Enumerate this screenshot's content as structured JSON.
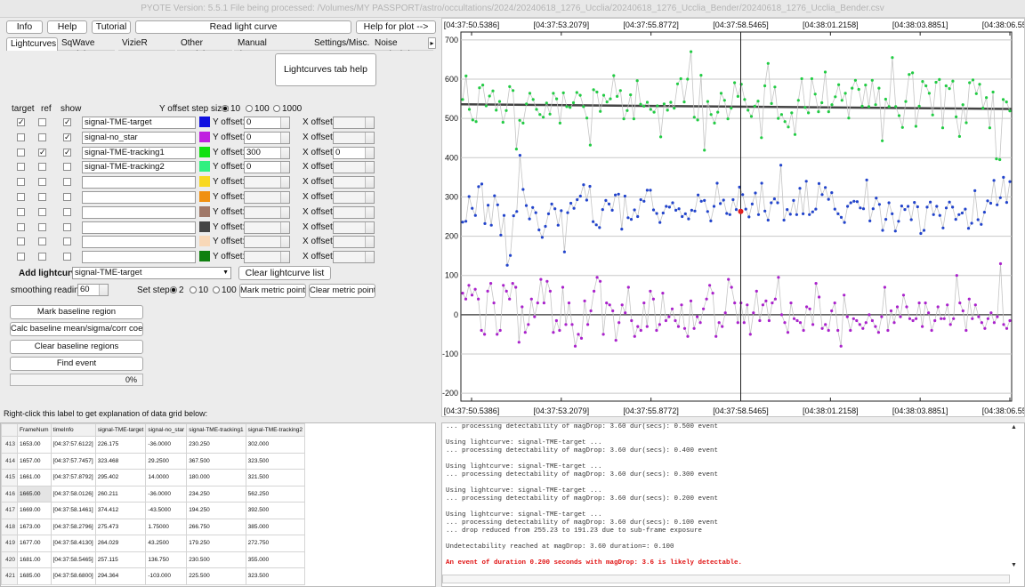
{
  "window": {
    "title": "PYOTE Version: 5.5.1  File being processed: /Volumes/MY PASSPORT/astro/occultations/2024/20240618_1276_Ucclia/20240618_1276_Ucclia_Bender/20240618_1276_Ucclia_Bender.csv"
  },
  "toolbar": {
    "info": "Info",
    "help": "Help",
    "tutorial": "Tutorial",
    "read": "Read light curve",
    "help_plot": "Help for plot -->"
  },
  "tabs": [
    "Lightcurves",
    "SqWave model",
    "VizieR export",
    "Other models",
    "Manual timestamps",
    "Settings/Misc.",
    "Noise analysis/"
  ],
  "lc": {
    "help_btn": "Lightcurves tab help",
    "hdr_target": "target",
    "hdr_ref": "ref",
    "hdr_show": "show",
    "yoffset_step": "Y offset step size:",
    "steps": [
      "10",
      "100",
      "1000"
    ],
    "y_label": "Y offset:",
    "x_label": "X offset:",
    "rows": [
      {
        "name": "signal-TME-target",
        "color": "#1010e0",
        "target": "✓",
        "ref": "",
        "show": "✓",
        "y": "0",
        "x": ""
      },
      {
        "name": "signal-no_star",
        "color": "#c020e0",
        "target": "",
        "ref": "",
        "show": "✓",
        "y": "0",
        "x": ""
      },
      {
        "name": "signal-TME-tracking1",
        "color": "#10e010",
        "target": "",
        "ref": "✓",
        "show": "✓",
        "y": "300",
        "x": "0"
      },
      {
        "name": "signal-TME-tracking2",
        "color": "#30f080",
        "target": "",
        "ref": "",
        "show": "",
        "y": "0",
        "x": ""
      },
      {
        "name": "",
        "color": "#f8d820",
        "target": "",
        "ref": "",
        "show": "",
        "y": "",
        "x": ""
      },
      {
        "name": "",
        "color": "#f09010",
        "target": "",
        "ref": "",
        "show": "",
        "y": "",
        "x": ""
      },
      {
        "name": "",
        "color": "#a07868",
        "target": "",
        "ref": "",
        "show": "",
        "y": "",
        "x": ""
      },
      {
        "name": "",
        "color": "#444444",
        "target": "",
        "ref": "",
        "show": "",
        "y": "",
        "x": ""
      },
      {
        "name": "",
        "color": "#f8d8b8",
        "target": "",
        "ref": "",
        "show": "",
        "y": "",
        "x": ""
      },
      {
        "name": "",
        "color": "#108010",
        "target": "",
        "ref": "",
        "show": "",
        "y": "",
        "x": ""
      }
    ],
    "add_label": "Add lightcurve",
    "add_value": "signal-TME-target",
    "clear_btn": "Clear lightcurve list",
    "smooth_label": "smoothing readings",
    "smooth_value": "60",
    "setstep_label": "Set step:",
    "setsteps": [
      "2",
      "10",
      "100"
    ],
    "mark_metric": "Mark metric points",
    "clear_metric": "Clear metric points",
    "mark_baseline": "Mark baseline region",
    "calc_baseline": "Calc baseline mean/sigma/corr coeffs",
    "clear_baseline": "Clear baseline regions",
    "find_event": "Find event",
    "progress": "0%"
  },
  "chart_data": {
    "type": "scatter",
    "x_ticks": [
      "[04:37:50.5386]",
      "[04:37:53.2079]",
      "[04:37:55.8772]",
      "[04:37:58.5465]",
      "[04:38:01.2158]",
      "[04:38:03.8851]",
      "[04:38:06.5544]"
    ],
    "y_ticks": [
      "700",
      "600",
      "500",
      "400",
      "300",
      "200",
      "100",
      "0",
      "-100",
      "-200"
    ],
    "ylim": [
      -220,
      720
    ],
    "baselines": [
      530,
      0
    ],
    "cursor_time": "[04:37:58.5465]",
    "highlight_value": 263,
    "series": [
      {
        "color": "#22cc44",
        "values": [
          548,
          608,
          523,
          496,
          492,
          578,
          585,
          532,
          557,
          570,
          521,
          543,
          490,
          520,
          581,
          571,
          422,
          495,
          488,
          537,
          564,
          548,
          523,
          510,
          503,
          539,
          511,
          564,
          550,
          488,
          565,
          530,
          528,
          540,
          566,
          559,
          530,
          501,
          432,
          573,
          567,
          518,
          559,
          542,
          550,
          609,
          556,
          571,
          499,
          520,
          560,
          499,
          596,
          536,
          531,
          541,
          523,
          516,
          532,
          453,
          537,
          521,
          541,
          526,
          588,
          601,
          542,
          600,
          670,
          503,
          496,
          610,
          419,
          543,
          510,
          488,
          516,
          564,
          546,
          499,
          526,
          591,
          556,
          587,
          548,
          521,
          505,
          531,
          544,
          451,
          583,
          640,
          538,
          580,
          500,
          510,
          492,
          478,
          514,
          459,
          546,
          601,
          528,
          514,
          601,
          562,
          517,
          540,
          618,
          517,
          535,
          555,
          586,
          546,
          564,
          501,
          577,
          597,
          574,
          531,
          585,
          530,
          597,
          535,
          577,
          443,
          549,
          530,
          655,
          530,
          507,
          477,
          543,
          612,
          616,
          480,
          531,
          594,
          583,
          564,
          509,
          592,
          599,
          476,
          583,
          576,
          595,
          504,
          454,
          535,
          489,
          591,
          598,
          563,
          587,
          526,
          553,
          476,
          567,
          397,
          395,
          548,
          542,
          519
        ]
      },
      {
        "color": "#2244cc",
        "values": [
          236,
          238,
          301,
          271,
          253,
          326,
          333,
          232,
          279,
          228,
          303,
          280,
          203,
          253,
          126,
          151,
          252,
          263,
          406,
          319,
          278,
          244,
          273,
          260,
          216,
          197,
          225,
          257,
          282,
          270,
          228,
          265,
          160,
          260,
          284,
          271,
          293,
          302,
          331,
          292,
          327,
          237,
          229,
          222,
          268,
          291,
          282,
          266,
          305,
          307,
          218,
          302,
          247,
          243,
          267,
          250,
          293,
          289,
          317,
          317,
          267,
          258,
          235,
          259,
          276,
          274,
          285,
          266,
          270,
          250,
          257,
          244,
          266,
          264,
          305,
          289,
          291,
          263,
          239,
          276,
          335,
          283,
          292,
          258,
          255,
          293,
          268,
          325,
          306,
          269,
          249,
          282,
          310,
          255,
          335,
          264,
          241,
          285,
          295,
          285,
          381,
          241,
          268,
          256,
          291,
          255,
          322,
          257,
          340,
          255,
          262,
          269,
          334,
          306,
          324,
          294,
          311,
          269,
          257,
          248,
          235,
          276,
          285,
          289,
          288,
          272,
          270,
          343,
          239,
          270,
          297,
          281,
          215,
          243,
          285,
          257,
          213,
          238,
          277,
          268,
          276,
          242,
          286,
          275,
          207,
          215,
          274,
          287,
          255,
          276,
          253,
          221,
          272,
          287,
          274,
          243,
          255,
          259,
          269,
          220,
          233,
          316,
          242,
          230,
          261,
          290,
          284,
          342,
          280,
          298,
          350,
          286,
          339
        ]
      },
      {
        "color": "#aa22cc",
        "values": [
          55,
          40,
          75,
          50,
          65,
          40,
          -40,
          -50,
          60,
          80,
          30,
          -50,
          -40,
          75,
          60,
          40,
          80,
          70,
          -70,
          20,
          -45,
          -25,
          40,
          -5,
          30,
          90,
          30,
          85,
          60,
          -45,
          -15,
          -40,
          70,
          -25,
          30,
          -25,
          -80,
          -50,
          -60,
          35,
          -25,
          10,
          60,
          95,
          85,
          -50,
          30,
          25,
          10,
          -65,
          -20,
          25,
          5,
          70,
          -15,
          -55,
          -30,
          -40,
          30,
          -30,
          60,
          40,
          -40,
          -25,
          55,
          -15,
          -5,
          15,
          -15,
          -30,
          25,
          -35,
          -55,
          35,
          -35,
          -5,
          -20,
          15,
          40,
          75,
          55,
          -55,
          -20,
          -30,
          5,
          90,
          70,
          30,
          -20,
          30,
          -20,
          25,
          -50,
          5,
          60,
          -15,
          25,
          35,
          -15,
          30,
          40,
          95,
          0,
          -20,
          -45,
          30,
          -10,
          -15,
          -20,
          -40,
          20,
          15,
          -25,
          80,
          45,
          -35,
          -25,
          -40,
          10,
          30,
          -40,
          -80,
          50,
          -5,
          -40,
          -10,
          -15,
          -25,
          -35,
          -20,
          0,
          -15,
          -30,
          -45,
          -5,
          70,
          -40,
          10,
          -20,
          20,
          -5,
          50,
          20,
          -10,
          -15,
          -10,
          30,
          -30,
          30,
          5,
          -40,
          -15,
          20,
          -10,
          -10,
          25,
          -25,
          -10,
          100,
          30,
          10,
          -40,
          40,
          -10,
          25,
          -5,
          -20,
          -35,
          -10,
          5,
          -20,
          -5,
          130,
          -25,
          -35,
          -15
        ]
      }
    ]
  },
  "grid": {
    "label": "Right-click this label to get explanation of data grid below:",
    "headers": [
      "",
      "FrameNum",
      "timeInfo",
      "signal-TME-target",
      "signal-no_star",
      "signal-TME-tracking1",
      "signal-TME-tracking2"
    ],
    "rows": [
      [
        "413",
        "1653.00",
        "[04:37:57.6122]",
        "226.175",
        "-36.0000",
        "230.250",
        "302.000"
      ],
      [
        "414",
        "1657.00",
        "[04:37:57.7457]",
        "323.468",
        "29.2500",
        "367.500",
        "323.500"
      ],
      [
        "415",
        "1661.00",
        "[04:37:57.8792]",
        "295.402",
        "14.0000",
        "180.000",
        "321.500"
      ],
      [
        "416",
        "1665.00",
        "[04:37:58.0126]",
        "260.211",
        "-36.0000",
        "234.250",
        "562.250"
      ],
      [
        "417",
        "1669.00",
        "[04:37:58.1461]",
        "374.412",
        "-43.5000",
        "194.250",
        "392.500"
      ],
      [
        "418",
        "1673.00",
        "[04:37:58.2796]",
        "275.473",
        "1.75000",
        "266.750",
        "385.000"
      ],
      [
        "419",
        "1677.00",
        "[04:37:58.4130]",
        "264.029",
        "43.2500",
        "179.250",
        "272.750"
      ],
      [
        "420",
        "1681.00",
        "[04:37:58.5465]",
        "257.115",
        "136.750",
        "230.500",
        "355.000"
      ],
      [
        "421",
        "1685.00",
        "[04:37:58.6800]",
        "294.364",
        "-103.000",
        "225.500",
        "323.500"
      ]
    ]
  },
  "log": {
    "lines": [
      "... processing detectability of magDrop: 3.60 dur(secs): 0.500 event",
      "",
      "Using lightcurve: signal-TME-target ...",
      "... processing detectability of magDrop: 3.60 dur(secs): 0.400 event",
      "",
      "Using lightcurve: signal-TME-target ...",
      "... processing detectability of magDrop: 3.60 dur(secs): 0.300 event",
      "",
      "Using lightcurve: signal-TME-target ...",
      "... processing detectability of magDrop: 3.60 dur(secs): 0.200 event",
      "",
      "Using lightcurve: signal-TME-target ...",
      "... processing detectability of magDrop: 3.60 dur(secs): 0.100 event",
      "... drop reduced from 255.23 to 191.23 due to sub-frame exposure",
      "",
      "Undetectability reached at magDrop: 3.60 duration=: 0.100",
      ""
    ],
    "highlight": "An event of duration 0.200 seconds with magDrop: 3.6 is likely detectable."
  }
}
